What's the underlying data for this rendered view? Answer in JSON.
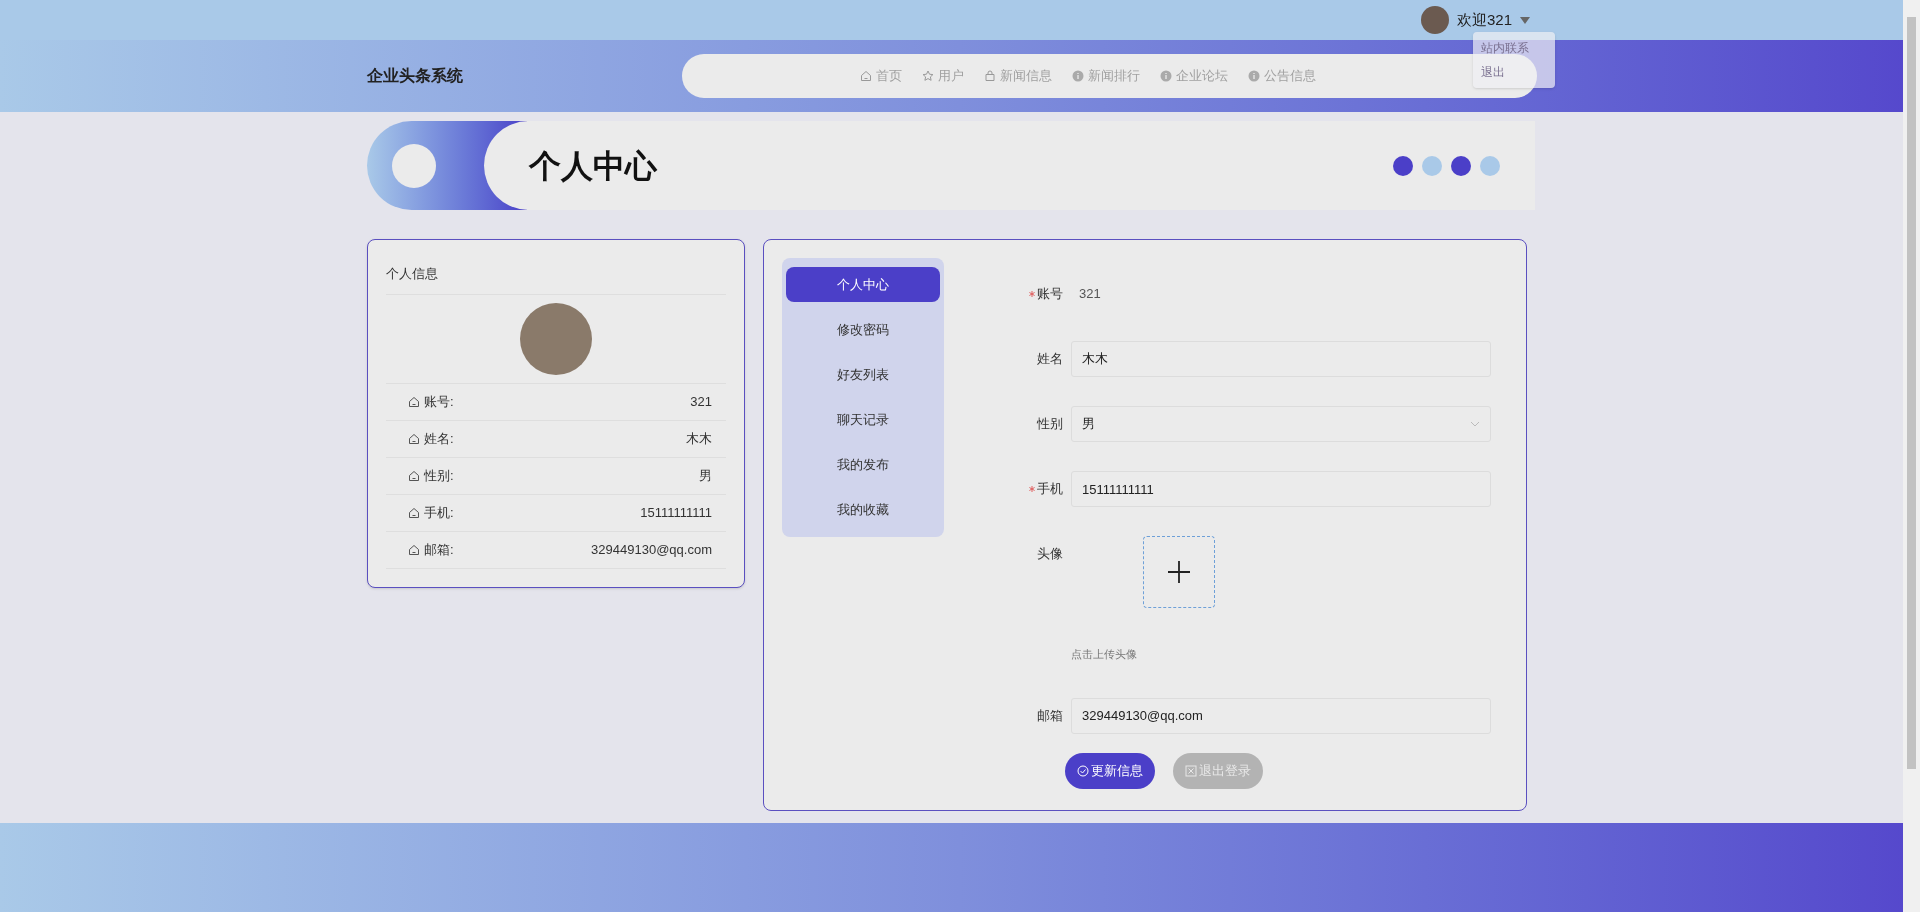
{
  "user_menu": {
    "greeting": "欢迎321",
    "items": [
      {
        "label": "站内联系",
        "selected": false
      },
      {
        "label": "退出",
        "selected": false
      }
    ]
  },
  "header": {
    "logo": "企业头条系统",
    "nav": [
      {
        "label": "首页",
        "selected": false
      },
      {
        "label": "用户",
        "selected": false
      },
      {
        "label": "新闻信息",
        "selected": false
      },
      {
        "label": "新闻排行",
        "selected": false
      },
      {
        "label": "企业论坛",
        "selected": false
      },
      {
        "label": "公告信息",
        "selected": false
      }
    ]
  },
  "banner": {
    "title": "个人中心"
  },
  "profile_card": {
    "title": "个人信息",
    "fields": [
      {
        "label": "账号:",
        "value": "321"
      },
      {
        "label": "姓名:",
        "value": "木木"
      },
      {
        "label": "性别:",
        "value": "男"
      },
      {
        "label": "手机:",
        "value": "15111111111"
      },
      {
        "label": "邮箱:",
        "value": "329449130@qq.com"
      }
    ]
  },
  "side_menu": [
    {
      "label": "个人中心",
      "selected": true
    },
    {
      "label": "修改密码",
      "selected": false
    },
    {
      "label": "好友列表",
      "selected": false
    },
    {
      "label": "聊天记录",
      "selected": false
    },
    {
      "label": "我的发布",
      "selected": false
    },
    {
      "label": "我的收藏",
      "selected": false
    }
  ],
  "form": {
    "fields": [
      {
        "kind": "text",
        "label": "账号",
        "required": true,
        "value": "321"
      },
      {
        "kind": "input",
        "label": "姓名",
        "required": false,
        "value": "木木"
      },
      {
        "kind": "select",
        "label": "性别",
        "required": false,
        "value": "男"
      },
      {
        "kind": "input",
        "label": "手机",
        "required": true,
        "value": "15111111111"
      },
      {
        "kind": "upload",
        "label": "头像",
        "required": false,
        "hint": "点击上传头像"
      },
      {
        "kind": "input",
        "label": "邮箱",
        "required": false,
        "value": "329449130@qq.com"
      }
    ],
    "buttons": [
      {
        "label": "更新信息",
        "kind": "primary"
      },
      {
        "label": "退出登录",
        "kind": "muted"
      }
    ]
  }
}
